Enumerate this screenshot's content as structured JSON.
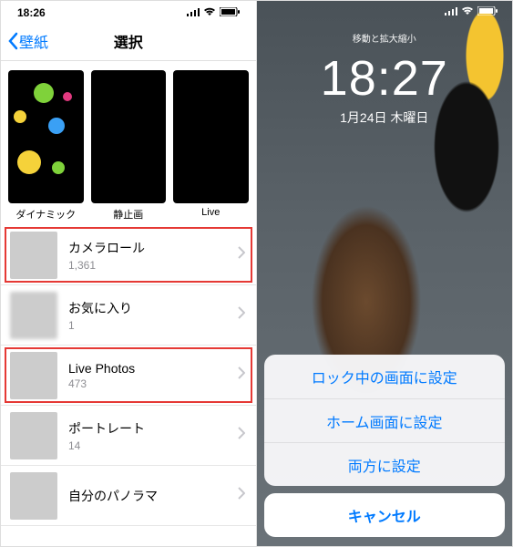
{
  "left": {
    "status_time": "18:26",
    "back_label": "壁紙",
    "title": "選択",
    "categories": [
      {
        "label": "ダイナミック"
      },
      {
        "label": "静止画"
      },
      {
        "label": "Live"
      }
    ],
    "albums": [
      {
        "name": "カメラロール",
        "count": "1,361",
        "highlight": true,
        "thumb": "th-roll"
      },
      {
        "name": "お気に入り",
        "count": "1",
        "highlight": false,
        "thumb": "th-fav"
      },
      {
        "name": "Live Photos",
        "count": "473",
        "highlight": true,
        "thumb": "th-live"
      },
      {
        "name": "ポートレート",
        "count": "14",
        "highlight": false,
        "thumb": "th-port"
      },
      {
        "name": "自分のパノラマ",
        "count": "",
        "highlight": false,
        "thumb": "th-pano"
      }
    ]
  },
  "right": {
    "hint": "移動と拡大縮小",
    "time": "18:27",
    "date": "1月24日 木曜日",
    "actions": [
      "ロック中の画面に設定",
      "ホーム画面に設定",
      "両方に設定"
    ],
    "cancel": "キャンセル"
  }
}
